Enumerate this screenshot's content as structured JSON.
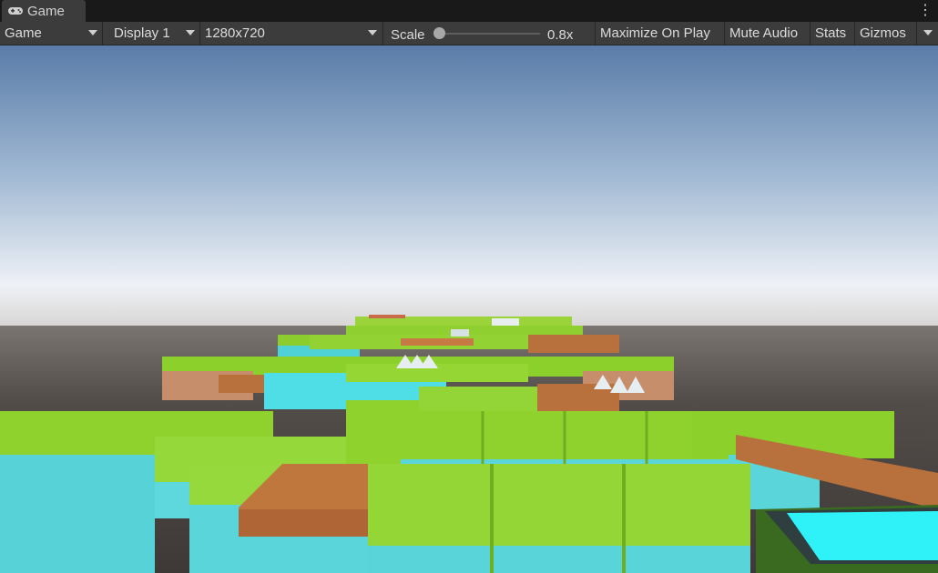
{
  "tab": {
    "label": "Game",
    "icon": "gamepad-icon"
  },
  "toolbar": {
    "view_mode": "Game",
    "display": "Display 1",
    "resolution": "1280x720",
    "scale_label": "Scale",
    "scale_value": "0.8x",
    "scale_level": 0.0,
    "maximize_label": "Maximize On Play",
    "mute_label": "Mute Audio",
    "stats_label": "Stats",
    "gizmos_label": "Gizmos"
  },
  "colors": {
    "grass": "#8fd22e",
    "water": "#52d6dd",
    "wood": "#b86a36",
    "sky_top": "#5c7fab",
    "ground": "#4a4542"
  }
}
